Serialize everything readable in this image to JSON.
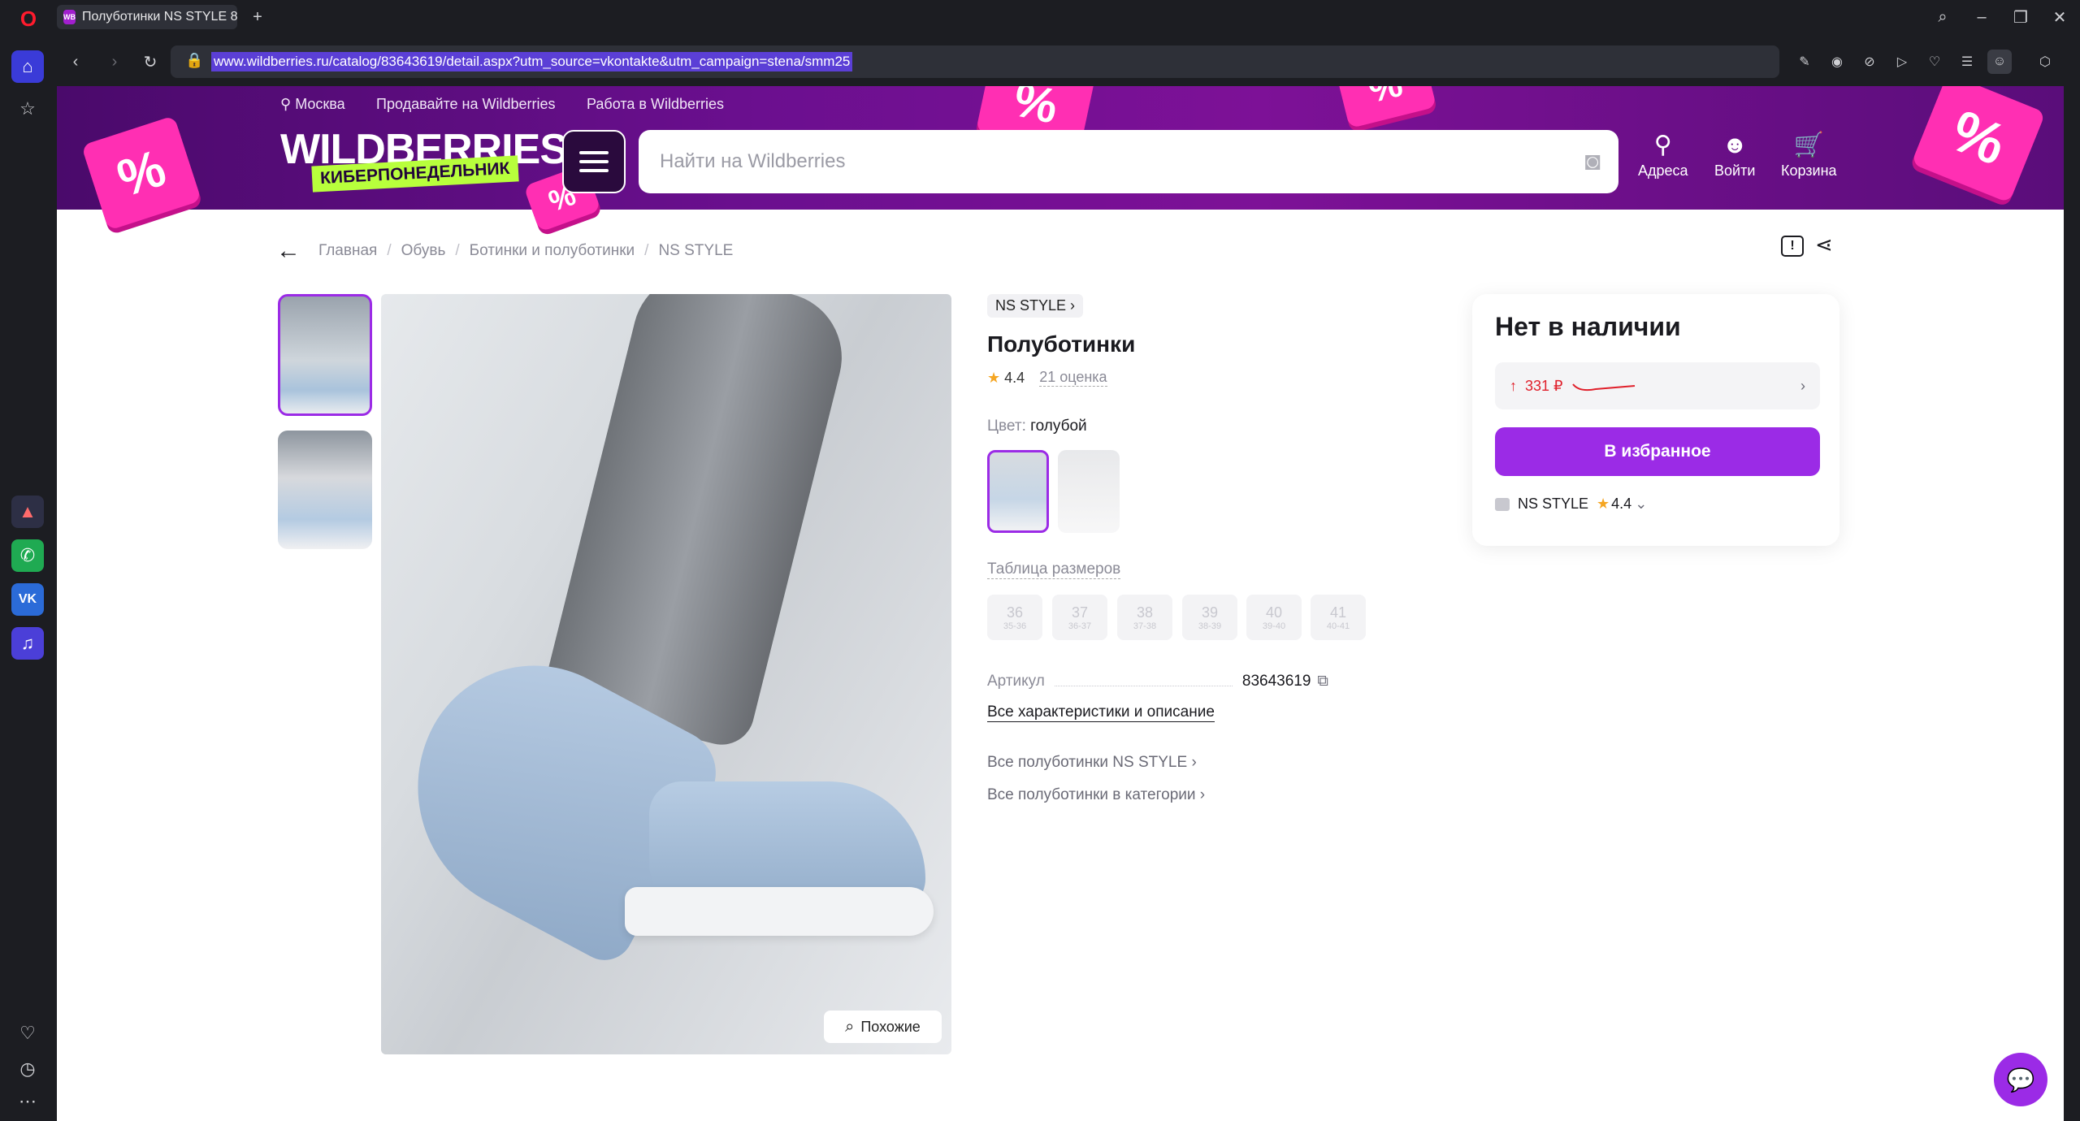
{
  "browser": {
    "tab_title": "Полуботинки NS STYLE 8",
    "tab_favicon": "WB",
    "url": "www.wildberries.ru/catalog/83643619/detail.aspx?utm_source=vkontakte&utm_campaign=stena/smm25"
  },
  "header": {
    "location": "Москва",
    "sell_link": "Продавайте на Wildberries",
    "jobs_link": "Работа в Wildberries",
    "logo": "WILDBERRIES",
    "promo_tag": "КИБЕРПОНЕДЕЛЬНИК",
    "search_placeholder": "Найти на Wildberries",
    "nav": {
      "addresses": "Адреса",
      "login": "Войти",
      "cart": "Корзина"
    }
  },
  "breadcrumb": [
    "Главная",
    "Обувь",
    "Ботинки и полуботинки",
    "NS STYLE"
  ],
  "product": {
    "brand": "NS STYLE",
    "title": "Полуботинки",
    "rating": "4.4",
    "reviews": "21 оценка",
    "color_label": "Цвет:",
    "color_value": "голубой",
    "size_table": "Таблица размеров",
    "sizes": [
      {
        "size": "36",
        "ru": "35-36"
      },
      {
        "size": "37",
        "ru": "36-37"
      },
      {
        "size": "38",
        "ru": "37-38"
      },
      {
        "size": "39",
        "ru": "38-39"
      },
      {
        "size": "40",
        "ru": "39-40"
      },
      {
        "size": "41",
        "ru": "40-41"
      }
    ],
    "article_label": "Артикул",
    "article_value": "83643619",
    "all_specs": "Все характеристики и описание",
    "brand_link": "Все полуботинки NS STYLE",
    "category_link": "Все полуботинки в категории",
    "similar_button": "Похожие"
  },
  "buy_card": {
    "status": "Нет в наличии",
    "price_change": "331 ₽",
    "favorite_button": "В избранное",
    "seller": "NS STYLE",
    "seller_rating": "4.4"
  },
  "colors": {
    "brand": "#9b2be6",
    "banner": "#6b0f8f",
    "promo": "#ff2fb3",
    "price_up": "#e0202b"
  }
}
